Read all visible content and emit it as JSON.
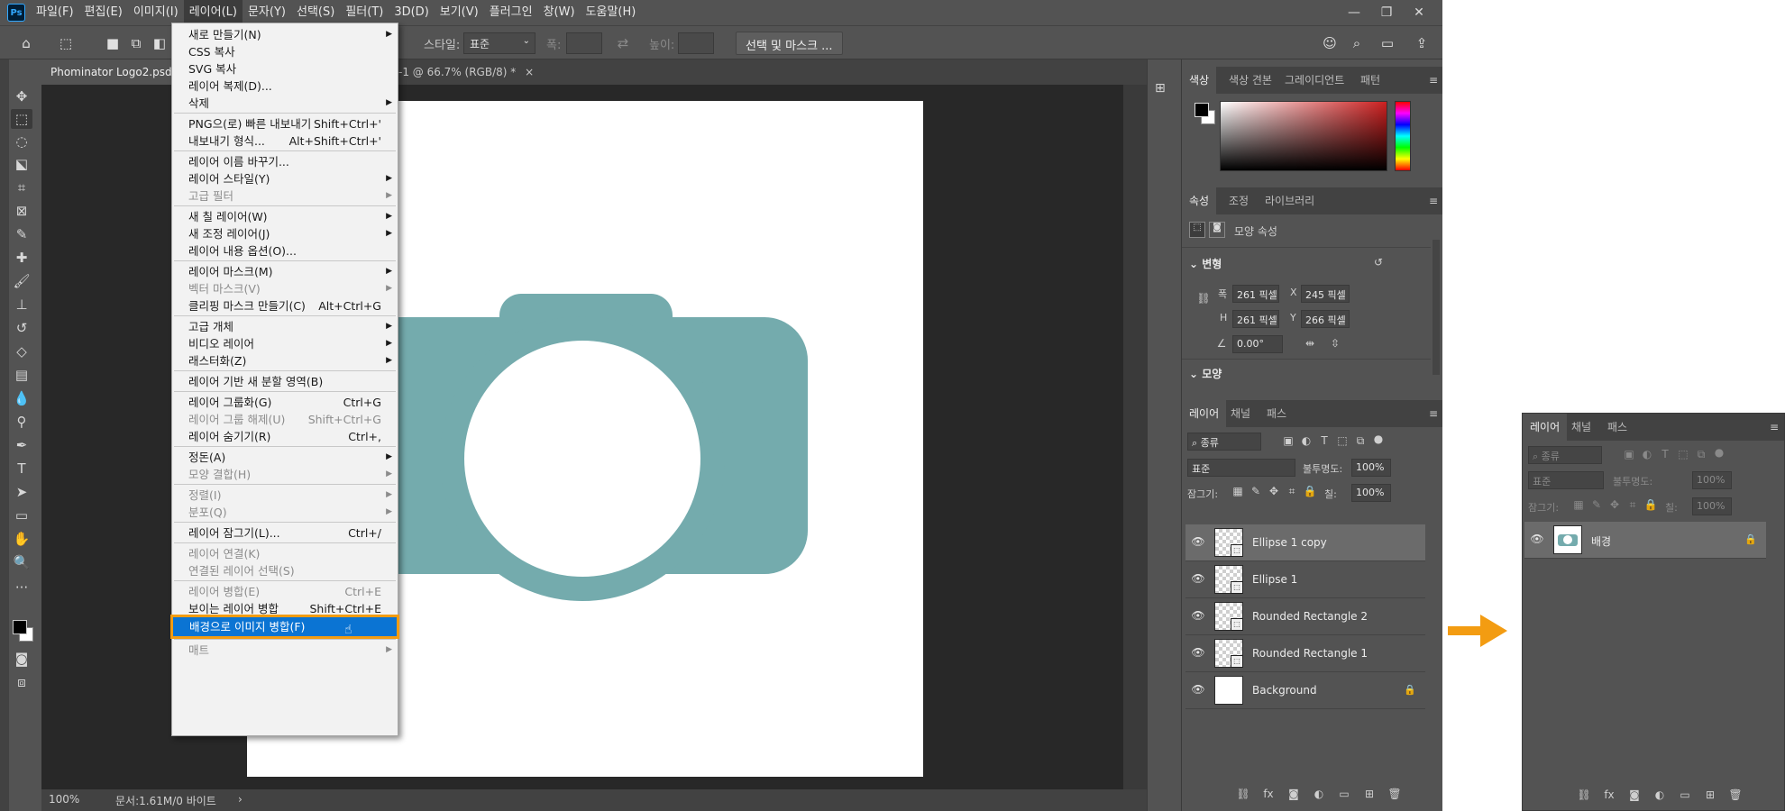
{
  "app": {
    "logo": "Ps"
  },
  "menubar": {
    "items": [
      "파일(F)",
      "편집(E)",
      "이미지(I)",
      "레이어(L)",
      "문자(Y)",
      "선택(S)",
      "필터(T)",
      "3D(D)",
      "보기(V)",
      "플러그인",
      "창(W)",
      "도움말(H)"
    ],
    "active_index": 3
  },
  "window_buttons": {
    "minimize": "—",
    "restore": "❐",
    "close": "✕"
  },
  "options_bar": {
    "style_label": "스타일:",
    "style_value": "표준",
    "width_label": "폭:",
    "height_label": "높이:",
    "select_mask_button": "선택 및 마스크 ..."
  },
  "document": {
    "tab_active": "Phominator Logo2.psd @",
    "tab_second": "-1 @ 66.7% (RGB/8) *",
    "tab_close": "×",
    "zoom": "100%",
    "doc_info": "문서:1.61M/0 바이트",
    "status_arrow": "›",
    "camera_color": "#74abad"
  },
  "layer_menu": {
    "items": [
      {
        "label": "새로 만들기(N)",
        "shortcut": "",
        "submenu": true,
        "disabled": false,
        "sep_before": false
      },
      {
        "label": "CSS 복사",
        "shortcut": "",
        "submenu": false,
        "disabled": false,
        "sep_before": false
      },
      {
        "label": "SVG 복사",
        "shortcut": "",
        "submenu": false,
        "disabled": false,
        "sep_before": false
      },
      {
        "label": "레이어 복제(D)...",
        "shortcut": "",
        "submenu": false,
        "disabled": false,
        "sep_before": false
      },
      {
        "label": "삭제",
        "shortcut": "",
        "submenu": true,
        "disabled": false,
        "sep_before": false
      },
      {
        "label": "PNG으(로) 빠른 내보내기",
        "shortcut": "Shift+Ctrl+'",
        "submenu": false,
        "disabled": false,
        "sep_before": true
      },
      {
        "label": "내보내기 형식...",
        "shortcut": "Alt+Shift+Ctrl+'",
        "submenu": false,
        "disabled": false,
        "sep_before": false
      },
      {
        "label": "레이어 이름 바꾸기...",
        "shortcut": "",
        "submenu": false,
        "disabled": false,
        "sep_before": true
      },
      {
        "label": "레이어 스타일(Y)",
        "shortcut": "",
        "submenu": true,
        "disabled": false,
        "sep_before": false
      },
      {
        "label": "고급 필터",
        "shortcut": "",
        "submenu": true,
        "disabled": true,
        "sep_before": false
      },
      {
        "label": "새 칠 레이어(W)",
        "shortcut": "",
        "submenu": true,
        "disabled": false,
        "sep_before": true
      },
      {
        "label": "새 조정 레이어(J)",
        "shortcut": "",
        "submenu": true,
        "disabled": false,
        "sep_before": false
      },
      {
        "label": "레이어 내용 옵션(O)...",
        "shortcut": "",
        "submenu": false,
        "disabled": false,
        "sep_before": false
      },
      {
        "label": "레이어 마스크(M)",
        "shortcut": "",
        "submenu": true,
        "disabled": false,
        "sep_before": true
      },
      {
        "label": "벡터 마스크(V)",
        "shortcut": "",
        "submenu": true,
        "disabled": true,
        "sep_before": false
      },
      {
        "label": "클리핑 마스크 만들기(C)",
        "shortcut": "Alt+Ctrl+G",
        "submenu": false,
        "disabled": false,
        "sep_before": false
      },
      {
        "label": "고급 개체",
        "shortcut": "",
        "submenu": true,
        "disabled": false,
        "sep_before": true
      },
      {
        "label": "비디오 레이어",
        "shortcut": "",
        "submenu": true,
        "disabled": false,
        "sep_before": false
      },
      {
        "label": "래스터화(Z)",
        "shortcut": "",
        "submenu": true,
        "disabled": false,
        "sep_before": false
      },
      {
        "label": "레이어 기반 새 분할 영역(B)",
        "shortcut": "",
        "submenu": false,
        "disabled": false,
        "sep_before": true
      },
      {
        "label": "레이어 그룹화(G)",
        "shortcut": "Ctrl+G",
        "submenu": false,
        "disabled": false,
        "sep_before": true
      },
      {
        "label": "레이어 그룹 해제(U)",
        "shortcut": "Shift+Ctrl+G",
        "submenu": false,
        "disabled": true,
        "sep_before": false
      },
      {
        "label": "레이어 숨기기(R)",
        "shortcut": "Ctrl+,",
        "submenu": false,
        "disabled": false,
        "sep_before": false
      },
      {
        "label": "정돈(A)",
        "shortcut": "",
        "submenu": true,
        "disabled": false,
        "sep_before": true
      },
      {
        "label": "모양 결합(H)",
        "shortcut": "",
        "submenu": true,
        "disabled": true,
        "sep_before": false
      },
      {
        "label": "정렬(I)",
        "shortcut": "",
        "submenu": true,
        "disabled": true,
        "sep_before": true
      },
      {
        "label": "분포(Q)",
        "shortcut": "",
        "submenu": true,
        "disabled": true,
        "sep_before": false
      },
      {
        "label": "레이어 잠그기(L)...",
        "shortcut": "Ctrl+/",
        "submenu": false,
        "disabled": false,
        "sep_before": true
      },
      {
        "label": "레이어 연결(K)",
        "shortcut": "",
        "submenu": false,
        "disabled": true,
        "sep_before": true
      },
      {
        "label": "연결된 레이어 선택(S)",
        "shortcut": "",
        "submenu": false,
        "disabled": true,
        "sep_before": false
      },
      {
        "label": "레이어 병합(E)",
        "shortcut": "Ctrl+E",
        "submenu": false,
        "disabled": true,
        "sep_before": true
      },
      {
        "label": "보이는 레이어 병합",
        "shortcut": "Shift+Ctrl+E",
        "submenu": false,
        "disabled": false,
        "sep_before": false
      },
      {
        "label": "배경으로 이미지 병합(F)",
        "shortcut": "",
        "submenu": false,
        "disabled": false,
        "sep_before": false,
        "highlighted": true
      },
      {
        "label": "매트",
        "shortcut": "",
        "submenu": true,
        "disabled": true,
        "sep_before": true
      }
    ],
    "highlight_outline": "#f39c12",
    "highlight_fill": "#0b74d3"
  },
  "color_panel": {
    "tabs": [
      "색상",
      "색상 견본",
      "그레이디언트",
      "패턴"
    ],
    "foreground": "#000000",
    "background": "#ffffff",
    "hue_color": "#cc2020"
  },
  "properties_panel": {
    "tabs": [
      "속성",
      "조정",
      "라이브러리"
    ],
    "type_label": "모양 속성",
    "transform_label": "변형",
    "w_label": "폭",
    "w_value": "261 픽셀",
    "x_label": "X",
    "x_value": "245 픽셀",
    "h_label": "H",
    "h_value": "261 픽셀",
    "y_label": "Y",
    "y_value": "266 픽셀",
    "angle_value": "0.00°",
    "shape_label": "모양"
  },
  "layers_panel": {
    "tabs": [
      "레이어",
      "채널",
      "패스"
    ],
    "filter_label": "종류",
    "blend_mode": "표준",
    "opacity_label": "불투명도:",
    "opacity_value": "100%",
    "lock_label": "잠그기:",
    "fill_label": "칠:",
    "fill_value": "100%",
    "layers": [
      {
        "name": "Ellipse 1 copy",
        "selected": true,
        "locked": false
      },
      {
        "name": "Ellipse 1",
        "selected": false,
        "locked": false
      },
      {
        "name": "Rounded Rectangle 2",
        "selected": false,
        "locked": false
      },
      {
        "name": "Rounded Rectangle 1",
        "selected": false,
        "locked": false
      },
      {
        "name": "Background",
        "selected": false,
        "locked": true
      }
    ],
    "footer_icons": [
      "link-icon",
      "fx-icon",
      "mask-icon",
      "adjustment-icon",
      "folder-icon",
      "new-layer-icon",
      "trash-icon"
    ]
  },
  "arrow_color": "#f39c12",
  "after_panel": {
    "tabs": [
      "레이어",
      "채널",
      "패스"
    ],
    "filter_label": "종류",
    "blend_mode": "표준",
    "opacity_label": "불투명도:",
    "opacity_value": "100%",
    "lock_label": "잠그기:",
    "fill_label": "칠:",
    "fill_value": "100%",
    "layer_name": "배경"
  }
}
